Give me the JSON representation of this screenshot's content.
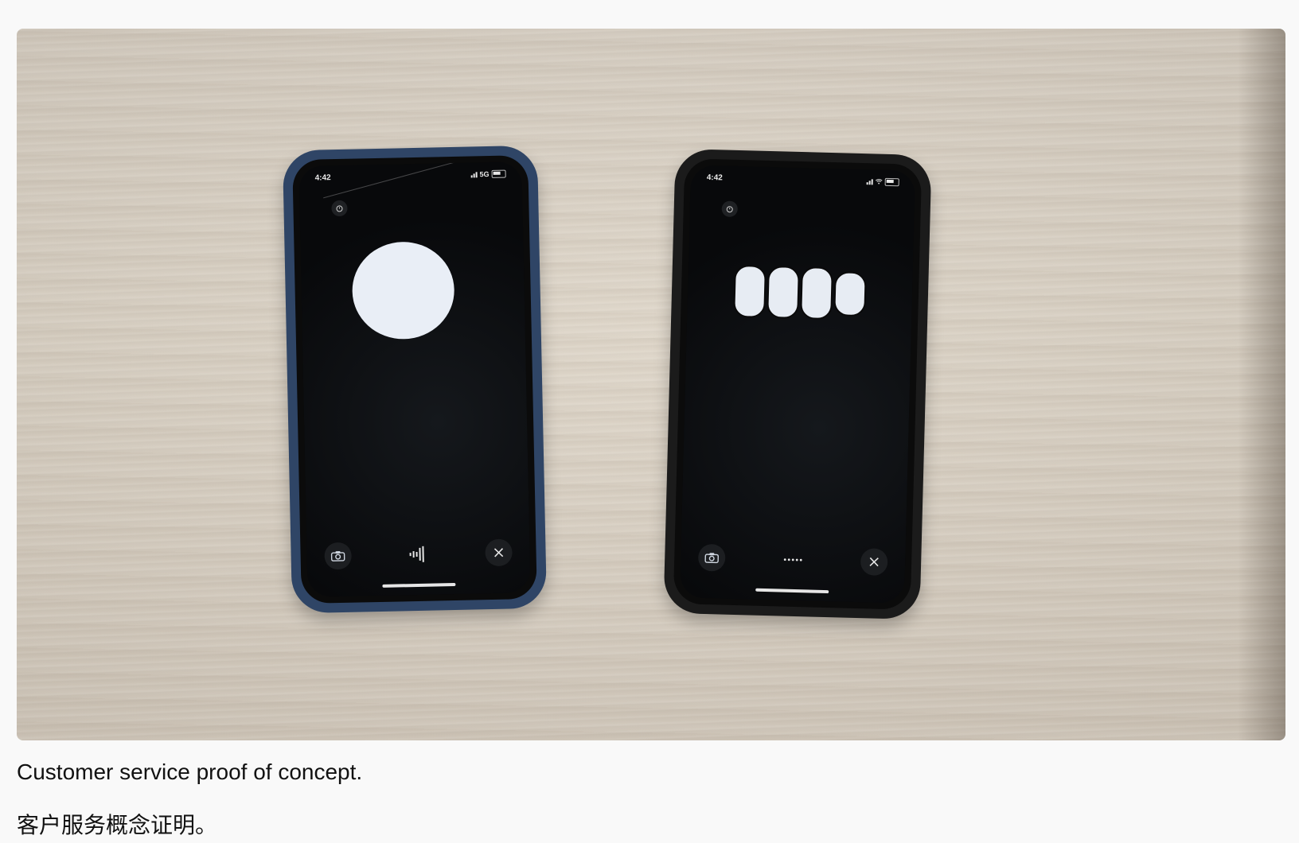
{
  "figure": {
    "left_phone": {
      "status_time": "4:42",
      "status_network": "5G",
      "state": "listening-circle"
    },
    "right_phone": {
      "status_time": "4:42",
      "state": "speaking-bars"
    }
  },
  "captions": {
    "english": "Customer service proof of concept.",
    "chinese": "客户服务概念证明。"
  },
  "colors": {
    "page_background": "#f9f9f9",
    "left_case": "#2f4566",
    "right_case": "#1b1b1b",
    "indicator": "#e9eef6"
  },
  "icons": {
    "top": "timer-icon",
    "camera": "camera-icon",
    "voice": "waveform-icon",
    "close": "close-icon"
  }
}
